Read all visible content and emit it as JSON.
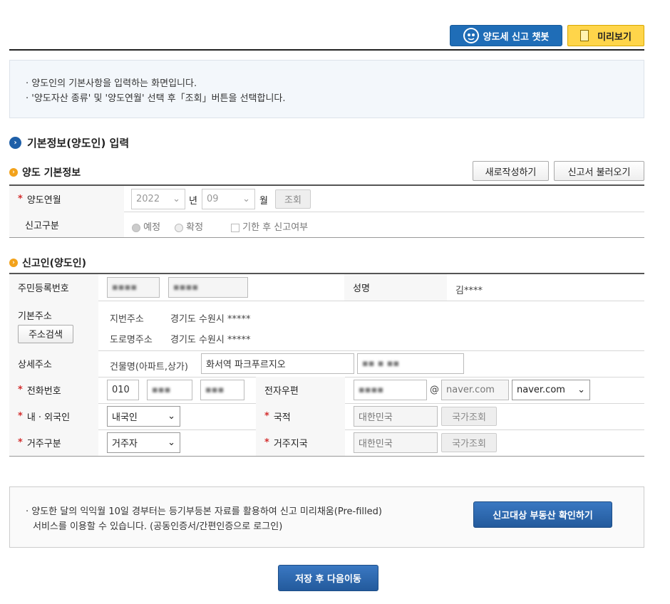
{
  "top": {
    "chatbot_label": "양도세 신고 챗봇",
    "preview_label": "미리보기"
  },
  "info": [
    "양도인의 기본사항을 입력하는 화면입니다.",
    "'양도자산 종류' 및 '양도연월' 선택 후「조회」버튼을 선택합니다."
  ],
  "section_title": "기본정보(양도인) 입력",
  "basic": {
    "title": "양도 기본정보",
    "new_button": "새로작성하기",
    "load_button": "신고서 불러오기",
    "yearmonth_label": "양도연월",
    "year_value": "2022",
    "year_unit": "년",
    "month_value": "09",
    "month_unit": "월",
    "query_button": "조회",
    "report_label": "신고구분",
    "radio_planned": "예정",
    "radio_confirmed": "확정",
    "late_check": "기한 후 신고여부"
  },
  "reporter": {
    "title": "신고인(양도인)",
    "rrn_label": "주민등록번호",
    "name_label": "성명",
    "name_value": "김****",
    "addr_label": "기본주소",
    "addr_search": "주소검색",
    "lot_label": "지번주소",
    "lot_value": "경기도 수원시 *****",
    "road_label": "도로명주소",
    "road_value": "경기도 수원시 *****",
    "detail_label": "상세주소",
    "building_label": "건물명(아파트,상가)",
    "building_value": "화서역 파크푸르지오",
    "phone_label": "전화번호",
    "phone_first": "010",
    "email_label": "전자우편",
    "email_domain": "naver.com",
    "email_select": "naver.com",
    "nation_type_label": "내 · 외국인",
    "nation_type_value": "내국인",
    "nationality_label": "국적",
    "nationality_value": "대한민국",
    "nation_search": "국가조회",
    "residence_label": "거주구분",
    "residence_value": "거주자",
    "residence_country_label": "거주지국",
    "residence_country_value": "대한민국",
    "country_search": "국가조회"
  },
  "notice": {
    "line1": "양도한 달의 익익월 10일 경부터는 등기부등본 자료를 활용하여 신고 미리채움(Pre-filled)",
    "line2": "서비스를 이용할 수 있습니다. (공동인증서/간편인증으로 로그인)",
    "button": "신고대상 부동산 확인하기"
  },
  "save_button": "저장 후 다음이동",
  "colors": {
    "accent_blue": "#1f6db7",
    "required_star": "#d32f2f",
    "preview_yellow": "#ffd54a"
  }
}
